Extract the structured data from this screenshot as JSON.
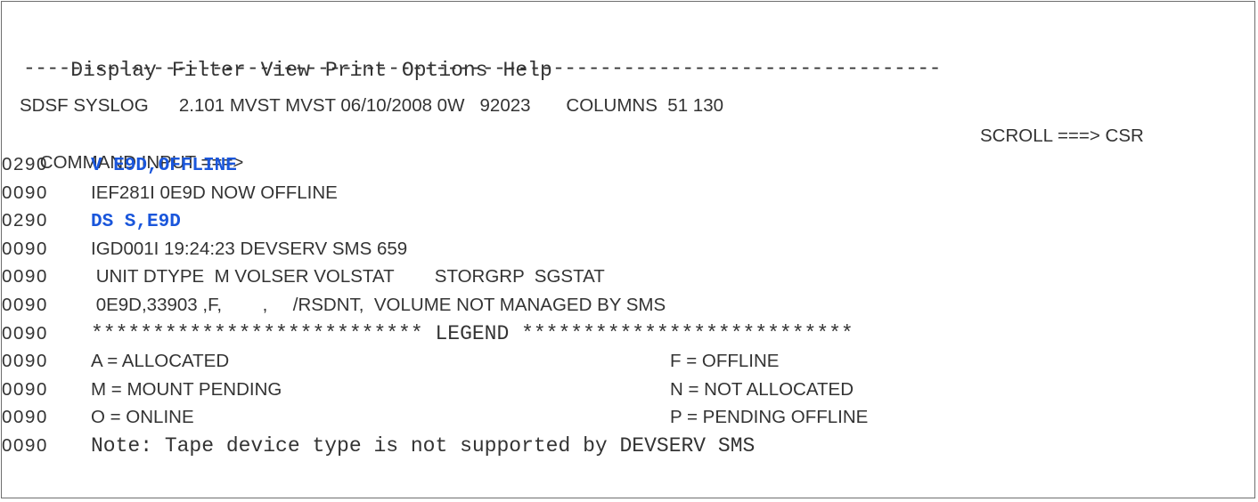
{
  "menu": {
    "items": [
      "Display",
      "Filter",
      "View",
      "Print",
      "Options",
      "Help"
    ]
  },
  "separator": "------------------------------------------------------------------------------",
  "header": {
    "line1": "SDSF SYSLOG      2.101 MVST MVST 06/10/2008 0W   92023       COLUMNS  51 130",
    "command_label": "COMMAND INPUT ===>",
    "command_value": "",
    "scroll_label": "SCROLL ===> CSR"
  },
  "log": [
    {
      "num": "0290",
      "text": "V E9D,OFFLINE",
      "kind": "command"
    },
    {
      "num": "0090",
      "text": "IEF281I 0E9D NOW OFFLINE",
      "kind": "msg"
    },
    {
      "num": "0290",
      "text": "DS S,E9D",
      "kind": "command"
    },
    {
      "num": "0090",
      "text": "IGD001I 19:24:23 DEVSERV SMS 659",
      "kind": "msg"
    },
    {
      "num": "0090",
      "text": " UNIT DTYPE  M VOLSER VOLSTAT        STORGRP  SGSTAT",
      "kind": "msg"
    },
    {
      "num": "0090",
      "text": " 0E9D,33903 ,F,        ,     /RSDNT,  VOLUME NOT MANAGED BY SMS",
      "kind": "msg"
    },
    {
      "num": "0090",
      "text": "*************************** LEGEND ***************************",
      "kind": "mono"
    },
    {
      "num": "0090",
      "left": "A = ALLOCATED",
      "right": "F = OFFLINE",
      "kind": "pair"
    },
    {
      "num": "0090",
      "left": "M = MOUNT PENDING",
      "right": "N = NOT ALLOCATED",
      "kind": "pair"
    },
    {
      "num": "0090",
      "left": "O = ONLINE",
      "right": "P = PENDING OFFLINE",
      "kind": "pair"
    },
    {
      "num": "0090",
      "text": "Note: Tape device type is not supported by DEVSERV SMS",
      "kind": "mono"
    }
  ]
}
